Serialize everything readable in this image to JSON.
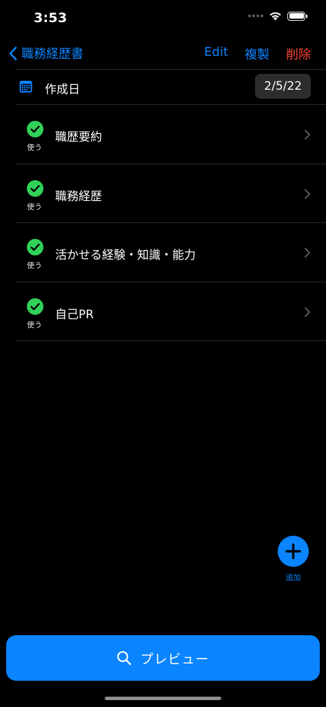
{
  "status_bar": {
    "time": "3:53"
  },
  "nav": {
    "back_label": "職務経歴書",
    "edit_label": "Edit",
    "duplicate_label": "複製",
    "delete_label": "削除"
  },
  "date_row": {
    "label": "作成日",
    "value": "2/5/22"
  },
  "sections": [
    {
      "title": "職歴要約",
      "status": "使う"
    },
    {
      "title": "職務経歴",
      "status": "使う"
    },
    {
      "title": "活かせる経験・知識・能力",
      "status": "使う"
    },
    {
      "title": "自己PR",
      "status": "使う"
    }
  ],
  "add_button": {
    "label": "追加"
  },
  "preview_button": {
    "label": "プレビュー"
  },
  "colors": {
    "accent": "#0a84ff",
    "destructive": "#ff453a",
    "check": "#30d158",
    "background": "#000000"
  }
}
